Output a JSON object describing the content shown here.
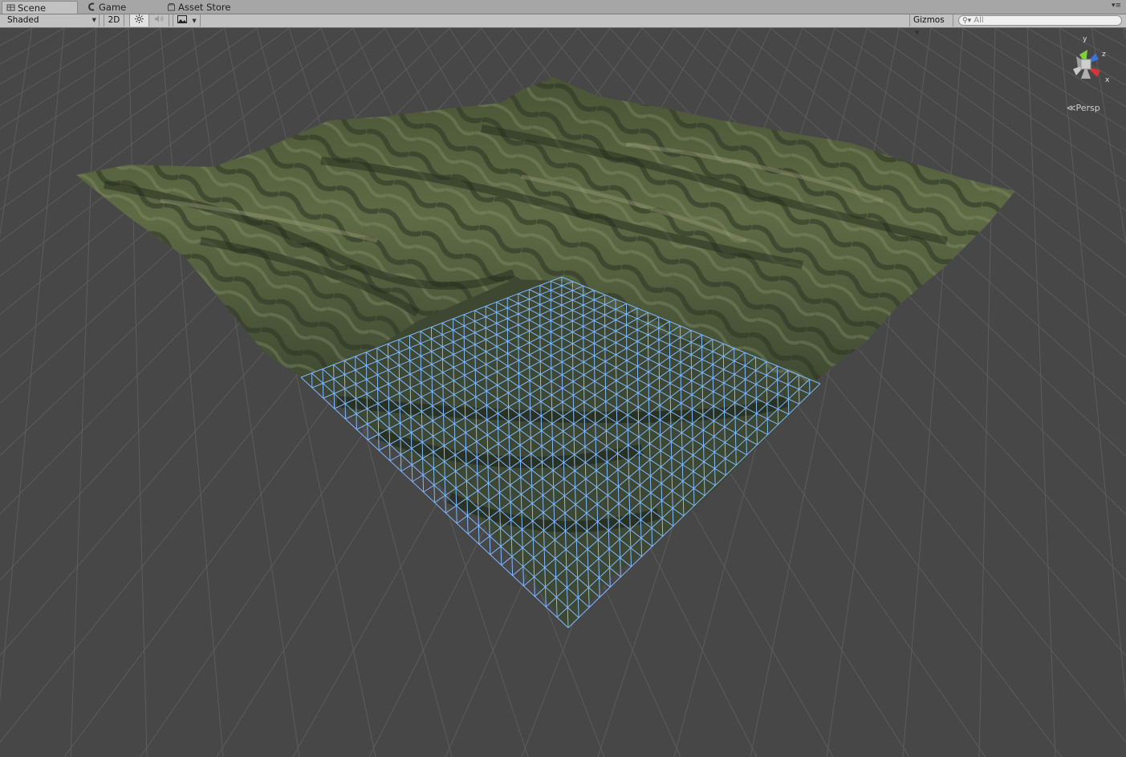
{
  "tabs": [
    {
      "label": "Scene",
      "icon": "scene-icon",
      "active": true
    },
    {
      "label": "Game",
      "icon": "game-icon",
      "active": false
    },
    {
      "label": "Asset Store",
      "icon": "asset-store-icon",
      "active": false
    }
  ],
  "toolbar": {
    "shading_mode": "Shaded",
    "mode_2d": "2D",
    "lighting_icon": "sun-icon",
    "audio_icon": "speaker-icon",
    "effects_icon": "image-icon",
    "gizmos_label": "Gizmos",
    "search_placeholder": "All"
  },
  "gizmo": {
    "axes": {
      "y": "y",
      "z": "z",
      "x": "x"
    },
    "projection": "Persp"
  },
  "colors": {
    "background": "#474747",
    "grid": "#5c5c5c",
    "wireframe": "#7fb8ff",
    "axis_y": "#7fd13b",
    "axis_z": "#3a72d8",
    "axis_x": "#d53737"
  }
}
